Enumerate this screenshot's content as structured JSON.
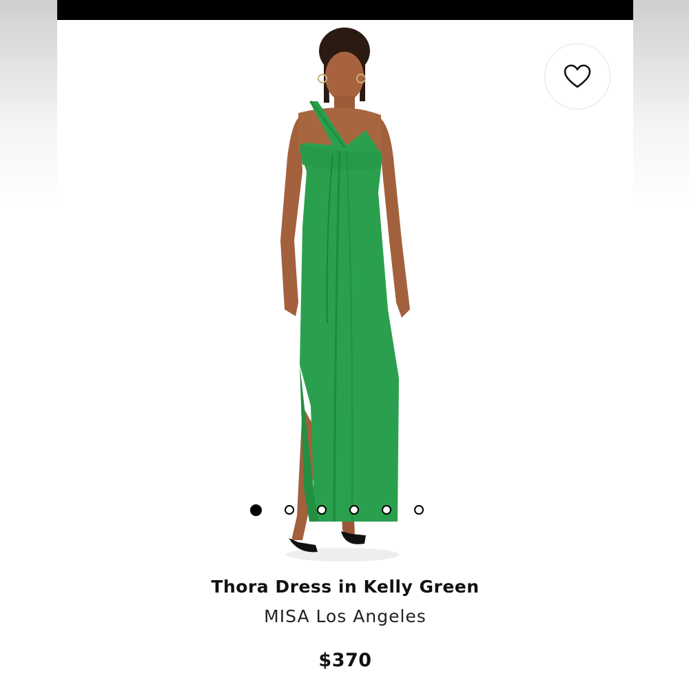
{
  "product": {
    "title": "Thora Dress in Kelly Green",
    "brand": "MISA Los Angeles",
    "price": "$370",
    "image_icon": "model-in-green-dress-photo",
    "dress_color": "#2aa04e"
  },
  "carousel": {
    "count": 6,
    "active_index": 0
  },
  "icons": {
    "wishlist": "heart-icon"
  }
}
